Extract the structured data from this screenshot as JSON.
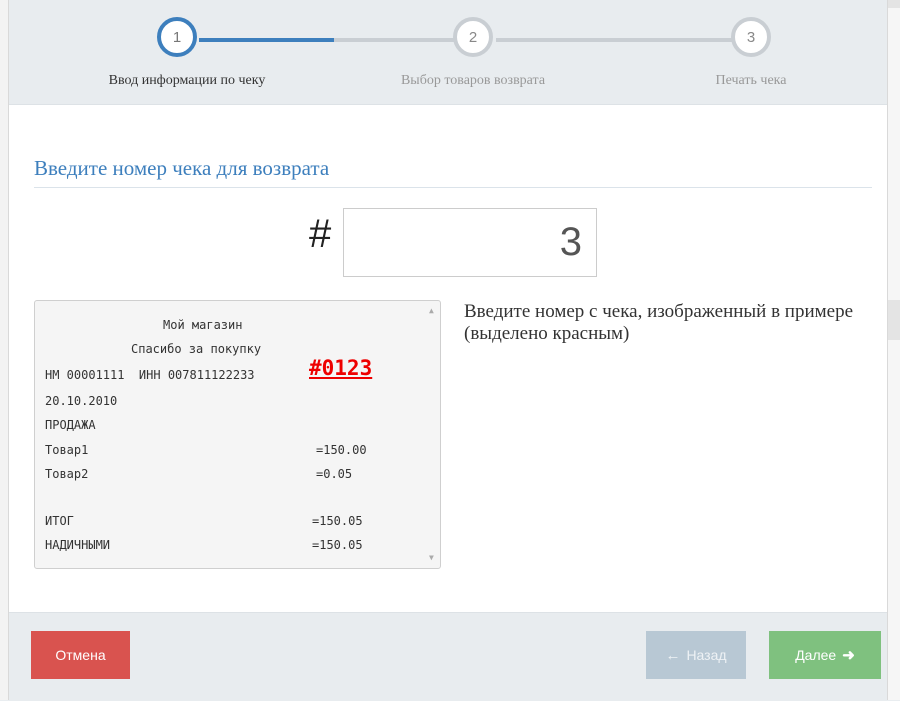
{
  "wizard": {
    "steps": [
      {
        "number": "1",
        "label": "Ввод информации по чеку",
        "state": "active"
      },
      {
        "number": "2",
        "label": "Выбор товаров возврата",
        "state": "inactive"
      },
      {
        "number": "3",
        "label": "Печать чека",
        "state": "inactive"
      }
    ]
  },
  "main": {
    "title": "Введите номер чека для возврата",
    "hash_symbol": "#",
    "receipt_number_value": "3",
    "hint": "Введите номер с чека, изображенный в примере (выделено красным)"
  },
  "receipt_example": {
    "store_name": "Мой магазин",
    "thanks": "Спасибо за покупку",
    "reg_line": "НМ 00001111  ИНН 007811122233",
    "highlight": "#0123",
    "date": "20.10.2010",
    "operation": "ПРОДАЖА",
    "items": [
      {
        "name": "Товар1",
        "amount": "=150.00"
      },
      {
        "name": "Товар2",
        "amount": "=0.05"
      }
    ],
    "total_label": "ИТОГ",
    "total_amount": "=150.05",
    "payment_label": "НАДИЧНЫМИ",
    "payment_amount": "=150.05"
  },
  "footer": {
    "cancel_label": "Отмена",
    "back_label": "Назад",
    "next_label": "Далее"
  },
  "colors": {
    "accent": "#3d7fbd",
    "cancel": "#d9534f",
    "next": "#7fc17f",
    "back_disabled": "#b8c8d4",
    "highlight_red": "#e00000"
  }
}
